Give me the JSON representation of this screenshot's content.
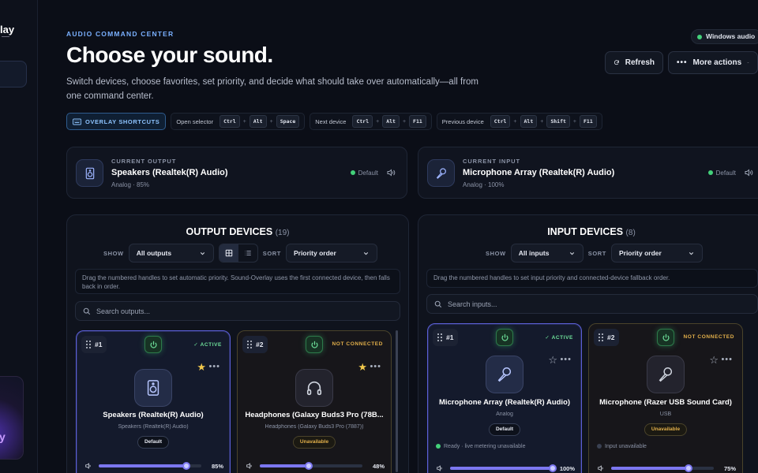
{
  "sidebar": {
    "brand": "lay",
    "promo_glyph": "y"
  },
  "header": {
    "eyebrow": "AUDIO COMMAND CENTER",
    "title": "Choose your sound.",
    "subtitle": "Switch devices, choose favorites, set priority, and decide what should take over automatically—all from one command center.",
    "status_chip": "Windows audio",
    "refresh_label": "Refresh",
    "more_label": "More actions"
  },
  "shortcuts": {
    "overlay_label": "OVERLAY SHORTCUTS",
    "groups": [
      {
        "label": "Open selector",
        "keys": [
          "Ctrl",
          "Alt",
          "Space"
        ]
      },
      {
        "label": "Next device",
        "keys": [
          "Ctrl",
          "Alt",
          "F11"
        ]
      },
      {
        "label": "Previous device",
        "keys": [
          "Ctrl",
          "Alt",
          "Shift",
          "F11"
        ]
      }
    ]
  },
  "current_output": {
    "label": "CURRENT OUTPUT",
    "name": "Speakers (Realtek(R) Audio)",
    "meta": "Analog · 85%",
    "default": "Default"
  },
  "current_input": {
    "label": "CURRENT INPUT",
    "name": "Microphone Array (Realtek(R) Audio)",
    "meta": "Analog · 100%",
    "default": "Default"
  },
  "output_panel": {
    "title": "OUTPUT DEVICES",
    "count": "(19)",
    "show_label": "SHOW",
    "show_value": "All outputs",
    "sort_label": "SORT",
    "sort_value": "Priority order",
    "hint": "Drag the numbered handles to set automatic priority. Sound-Overlay uses the first connected device, then falls back in order.",
    "search_placeholder": "Search outputs...",
    "devices": [
      {
        "num": "#1",
        "status": "ACTIVE",
        "name": "Speakers (Realtek(R) Audio)",
        "sub": "Speakers (Realtek(R) Audio)",
        "badge": "Default",
        "volume": "85%",
        "volume_value": 0.85,
        "favorite": true,
        "icon": "speaker-icon"
      },
      {
        "num": "#2",
        "status": "NOT CONNECTED",
        "name": "Headphones (Galaxy Buds3 Pro (78B...",
        "sub": "Headphones (Galaxy Buds3 Pro (7887))",
        "badge": "Unavailable",
        "volume": "48%",
        "volume_value": 0.48,
        "favorite": true,
        "icon": "headphones-icon"
      }
    ]
  },
  "input_panel": {
    "title": "INPUT DEVICES",
    "count": "(8)",
    "show_label": "SHOW",
    "show_value": "All inputs",
    "sort_label": "SORT",
    "sort_value": "Priority order",
    "hint": "Drag the numbered handles to set input priority and connected-device fallback order.",
    "search_placeholder": "Search inputs...",
    "devices": [
      {
        "num": "#1",
        "status": "ACTIVE",
        "name": "Microphone Array (Realtek(R) Audio)",
        "sub": "Analog",
        "badge": "Default",
        "live": "Ready · live metering unavailable",
        "volume": "100%",
        "volume_value": 1.0,
        "favorite": false,
        "icon": "microphone-icon"
      },
      {
        "num": "#2",
        "status": "NOT CONNECTED",
        "name": "Microphone (Razer USB Sound Card)",
        "sub": "USB",
        "badge": "Unavailable",
        "live": "Input unavailable",
        "volume": "75%",
        "volume_value": 0.75,
        "favorite": false,
        "icon": "microphone-icon"
      }
    ]
  },
  "colors": {
    "accent": "#7c77f0",
    "ok": "#43d17a",
    "warn": "#e3b04a",
    "link": "#7ab0ff"
  }
}
